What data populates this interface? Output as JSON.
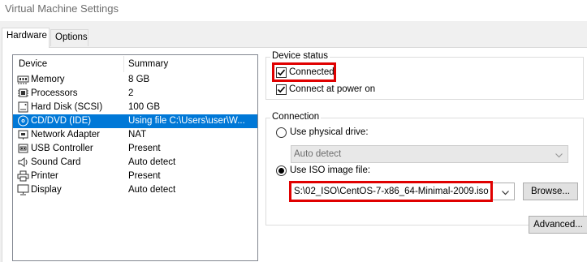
{
  "window": {
    "title": "Virtual Machine Settings"
  },
  "tabs": [
    {
      "label": "Hardware"
    },
    {
      "label": "Options"
    }
  ],
  "device_list": {
    "columns": {
      "device": "Device",
      "summary": "Summary"
    },
    "rows": [
      {
        "name": "Memory",
        "summary": "8 GB",
        "icon": "memory-icon"
      },
      {
        "name": "Processors",
        "summary": "2",
        "icon": "processor-icon"
      },
      {
        "name": "Hard Disk (SCSI)",
        "summary": "100 GB",
        "icon": "hard-disk-icon"
      },
      {
        "name": "CD/DVD (IDE)",
        "summary": "Using file C:\\Users\\user\\W...",
        "icon": "cd-dvd-icon",
        "selected": true
      },
      {
        "name": "Network Adapter",
        "summary": "NAT",
        "icon": "network-adapter-icon"
      },
      {
        "name": "USB Controller",
        "summary": "Present",
        "icon": "usb-icon"
      },
      {
        "name": "Sound Card",
        "summary": "Auto detect",
        "icon": "speaker-icon"
      },
      {
        "name": "Printer",
        "summary": "Present",
        "icon": "printer-icon"
      },
      {
        "name": "Display",
        "summary": "Auto detect",
        "icon": "monitor-icon"
      }
    ]
  },
  "device_status": {
    "label": "Device status",
    "connected": {
      "label": "Connected",
      "checked": true
    },
    "connect_at_power_on": {
      "label": "Connect at power on",
      "checked": true
    }
  },
  "connection": {
    "label": "Connection",
    "physical_drive": {
      "label": "Use physical drive:",
      "selected": false,
      "value": "Auto detect"
    },
    "iso_image": {
      "label": "Use ISO image file:",
      "selected": true,
      "value": "S:\\02_ISO\\CentOS-7-x86_64-Minimal-2009.iso"
    },
    "browse_label": "Browse..."
  },
  "advanced_label": "Advanced...",
  "colors": {
    "selection": "#0078d7",
    "highlight": "#e00000"
  }
}
